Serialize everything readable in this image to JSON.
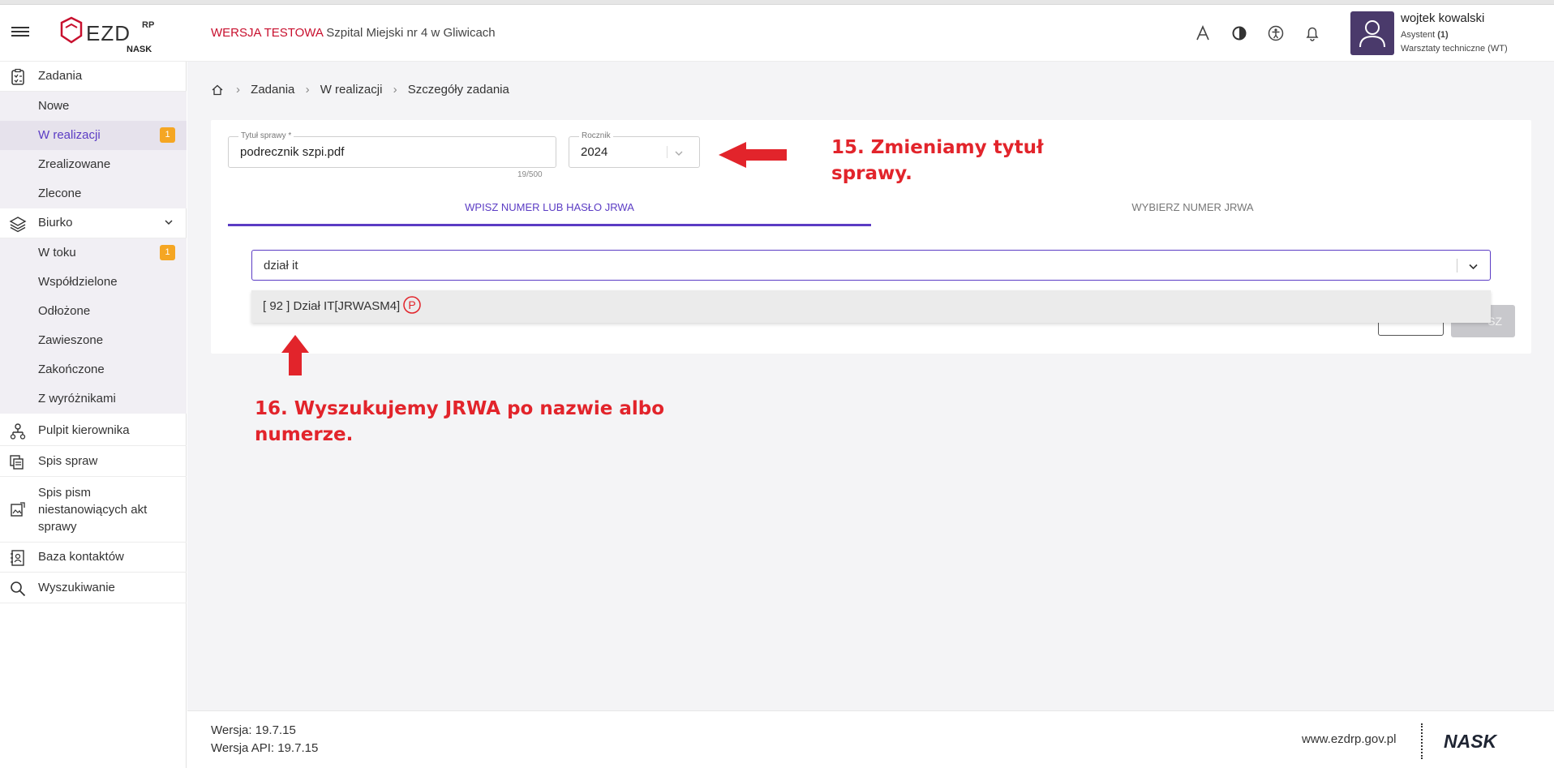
{
  "header": {
    "logo_text": "EZD",
    "logo_sup": "RP",
    "logo_sub": "NASK",
    "env_test": "WERSJA TESTOWA",
    "env_org": "Szpital Miejski nr 4 w Gliwicach",
    "user_name": "wojtek kowalski",
    "user_role": "Asystent",
    "user_role_count": "(1)",
    "user_dept": "Warsztaty techniczne (WT)",
    "accent": "#c8102e"
  },
  "sidebar": {
    "zadania": "Zadania",
    "nowe": "Nowe",
    "w_realizacji": "W realizacji",
    "w_realizacji_badge": "1",
    "zrealizowane": "Zrealizowane",
    "zlecone": "Zlecone",
    "biurko": "Biurko",
    "w_toku": "W toku",
    "w_toku_badge": "1",
    "wspoldzielone": "Współdzielone",
    "odlozone": "Odłożone",
    "zawieszone": "Zawieszone",
    "zakonczone": "Zakończone",
    "z_wyroznikami": "Z wyróżnikami",
    "pulpit": "Pulpit kierownika",
    "spis_spraw": "Spis spraw",
    "spis_pism_1": "Spis pism",
    "spis_pism_2": "niestanowiących akt",
    "spis_pism_3": "sprawy",
    "baza": "Baza kontaktów",
    "wyszukiwanie": "Wyszukiwanie"
  },
  "breadcrumb": {
    "c1": "Zadania",
    "c2": "W realizacji",
    "c3": "Szczegóły zadania"
  },
  "form": {
    "title_label": "Tytuł sprawy *",
    "title_value": "podrecznik szpi.pdf",
    "title_counter": "19/500",
    "year_label": "Rocznik",
    "year_value": "2024",
    "tab_enter": "WPISZ NUMER LUB HASŁO JRWA",
    "tab_choose": "WYBIERZ NUMER JRWA",
    "search_value": "dział it",
    "option_text": "[ 92 ] Dział IT[JRWASM4]",
    "option_mark": "P",
    "save_partial": "SZ"
  },
  "annotations": {
    "a15_line1": "15. Zmieniamy tytuł",
    "a15_line2": "sprawy.",
    "a16_line1": "16. Wyszukujemy JRWA po nazwie albo",
    "a16_line2": "numerze."
  },
  "footer": {
    "version": "Wersja: 19.7.15",
    "api_version": "Wersja API: 19.7.15",
    "site": "www.ezdrp.gov.pl",
    "brand": "NASK"
  }
}
